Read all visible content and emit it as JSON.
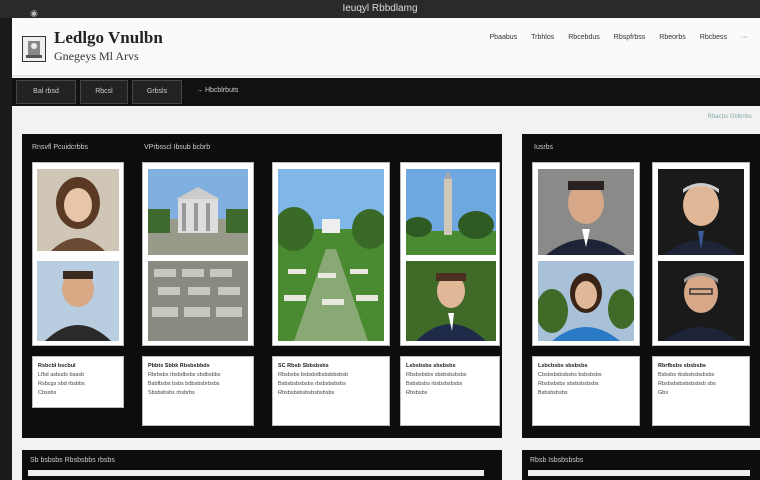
{
  "window": {
    "title": "Ieuqyl Rbbdlamg"
  },
  "site": {
    "title": "Ledlgo Vnulbn",
    "subtitle": "Gnegeys Ml Arvs"
  },
  "nav": [
    "Pbaabus",
    "Trbhlos",
    "Rbcebdus",
    "Rbspfrbss",
    "Rbeorbs",
    "Rbcbess",
    "···"
  ],
  "toolbar": {
    "btn1": "Bal rbsd",
    "btn2": "Rbcsl",
    "btn3": "Grbsls",
    "link": "→  Hbcblrbuts"
  },
  "crumb": "Rbacbs   Gblbnbs",
  "panels": {
    "left_label1": "Rnsvfl Pcuidcrbbs",
    "left_label2": "VPrbsscl Ibsub bcbrb",
    "right_label": "Iusrbs"
  },
  "texts": [
    {
      "title": "Rsbcbl bscbul",
      "lines": [
        "Lfbd asbuds bsasb",
        "Rsbcgs sbd rbsbbs",
        "Cbssbs"
      ]
    },
    {
      "title": "Pbbts Sbbk Rbsbsbbds",
      "lines": [
        "Rbrbsbs rbsbdbsbs sbdbsbbs",
        "Bsbfbsbs bsbs bdbsbsbrbsbs",
        "Sbsbsbsbs rbsbrbs"
      ]
    },
    {
      "title": "SC Rbsb Sbbsbsbs",
      "lines": [
        "Rbsbsbs bsbsbdbsbsbbsbsb",
        "Bsbsbsbsbsbs rbsbsbsbsbs",
        "Rbsbsbsbsbsbsbsbsbs"
      ]
    },
    {
      "title": "Lsbsbsbs sbsbsbs",
      "lines": [
        "Rbsbsbsbs sbsbsbsbsbs",
        "Bsbsbsbs rbsbsbsbsbs",
        "Rbsbsbs"
      ]
    },
    {
      "title": "Lsbcbsbs sbsbsbs",
      "lines": [
        "Cbsbsbsbsbsbs bsbsbsbs",
        "Rbsbsbsbs sbsbsbsbsbs",
        "Bsbsbsbsbs"
      ]
    },
    {
      "title": "Rbrfbsbs sbsbsbs",
      "lines": [
        "Bsbsbs rbsbsbsbsbsbs",
        "Rbsbsbsbsbsbsbsb sbs",
        "Gbs"
      ]
    }
  ],
  "bottom": {
    "left": "Sb bsbsbs   Rbsbsbbs rbsbs",
    "right": "Rbsb Isbsbsbsbs"
  },
  "colors": {
    "panel": "#0d0d0d",
    "toolbar": "#111111",
    "page": "#f2f2f2"
  }
}
